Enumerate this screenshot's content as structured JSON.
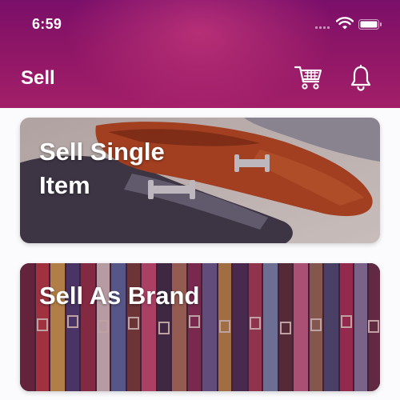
{
  "status_bar": {
    "time": "6:59"
  },
  "header": {
    "title": "Sell"
  },
  "icons": {
    "cart": "shopping-cart-icon",
    "notifications": "bell-icon"
  },
  "cards": [
    {
      "title": "Sell Single\nItem",
      "image": "loafer-shoes-photo"
    },
    {
      "title": "Sell As Brand",
      "image": "belts-rack-photo"
    }
  ],
  "colors": {
    "header_top": "#7a0f6a",
    "header_bottom": "#a31f69",
    "text_on_header": "#ffffff"
  }
}
